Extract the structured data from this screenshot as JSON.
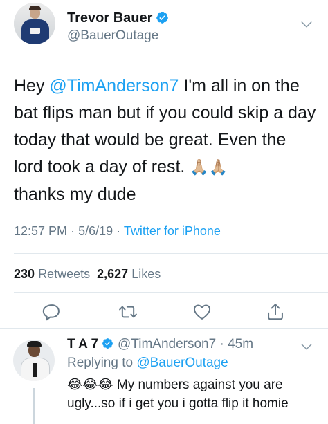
{
  "main_tweet": {
    "display_name": "Trevor Bauer",
    "handle": "@BauerOutage",
    "text_prefix": "Hey ",
    "mention": "@TimAnderson7",
    "text_body": " I'm all in on the bat flips man but if you could skip a day today that would be great. Even the lord took a day of rest. ",
    "emoji": "🙏🏼🙏🏼",
    "text_suffix": "thanks my dude",
    "time": "12:57 PM",
    "date": "5/6/19",
    "source": "Twitter for iPhone",
    "separator": "·",
    "retweets_count": "230",
    "retweets_label": "Retweets",
    "likes_count": "2,627",
    "likes_label": "Likes"
  },
  "reply": {
    "display_name": "T A 7",
    "handle": "@TimAnderson7",
    "separator": "·",
    "time": "45m",
    "replying_label": "Replying to",
    "replying_to": "@BauerOutage",
    "emoji": "😂😂😂",
    "text": " My numbers against you are ugly...so if i get you i gotta flip it homie"
  },
  "icons": {
    "verified": "verified-badge-icon",
    "more": "chevron-down-icon",
    "reply": "reply-icon",
    "retweet": "retweet-icon",
    "like": "heart-icon",
    "share": "share-icon"
  },
  "colors": {
    "accent": "#1da1f2",
    "text": "#14171a",
    "muted": "#657786",
    "divider": "#e1e8ed"
  }
}
